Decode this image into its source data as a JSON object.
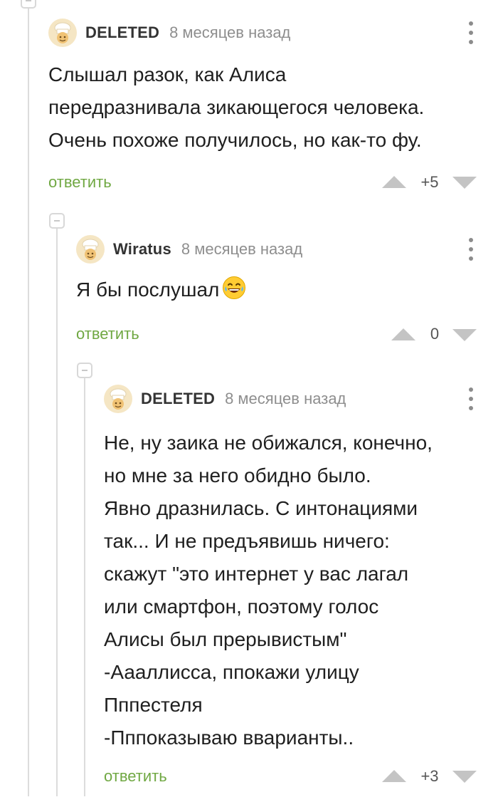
{
  "comments": [
    {
      "author": "DELETED",
      "time": "8 месяцев назад",
      "lines": [
        "Слышал разок, как Алиса",
        "передразнивала зикающегося человека.",
        "Очень похоже получилось, но как-то фу."
      ],
      "reply_label": "ответить",
      "rating": "+5"
    },
    {
      "author": "Wiratus",
      "time": "8 месяцев назад",
      "text": "Я бы послушал",
      "emoji": "grinning-sweat-emoji",
      "reply_label": "ответить",
      "rating": "0"
    },
    {
      "author": "DELETED",
      "time": "8 месяцев назад",
      "lines": [
        "Не, ну заика не обижался, конечно,",
        "но мне за него обидно было.",
        "Явно дразнилась. С интонациями",
        "так... И не предъявишь ничего:",
        "скажут \"это интернет у вас лагал",
        "или смартфон, поэтому голос",
        "Алисы был прерывистым\"",
        "-Аааллисса, ппокажи улицу",
        "Пппестеля",
        "-Пппоказываю вварианты.."
      ],
      "reply_label": "ответить",
      "rating": "+3"
    }
  ],
  "icons": {
    "avatar": "chef-avatar-icon",
    "menu": "more-vertical-icon",
    "upvote": "triangle-up-icon",
    "downvote": "triangle-down-icon",
    "collapse": "minus-collapse-icon"
  },
  "colors": {
    "reply_link": "#70a843",
    "thread_line": "#dcdcdc",
    "vote_arrow": "#c4c4c4",
    "meta_text": "#8e8e8e"
  }
}
